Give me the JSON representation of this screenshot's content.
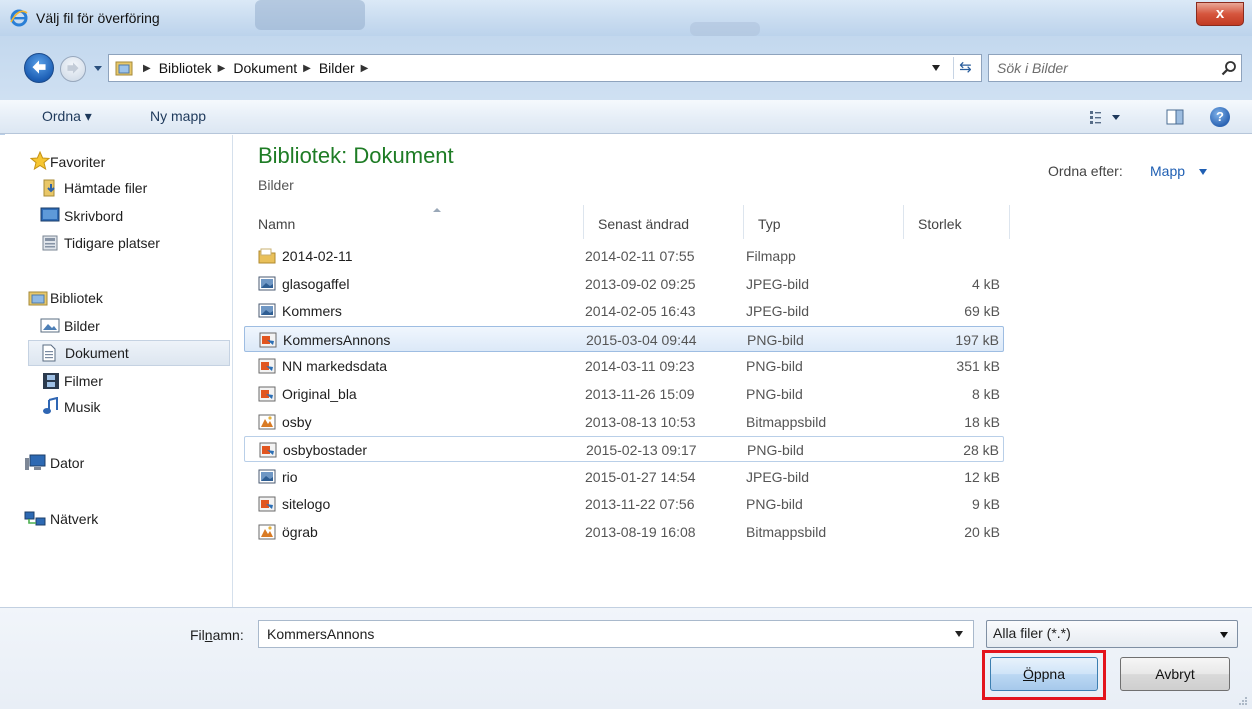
{
  "window": {
    "title": "Välj fil för överföring",
    "close_label": "x"
  },
  "breadcrumb": [
    "Bibliotek",
    "Dokument",
    "Bilder"
  ],
  "search": {
    "placeholder": "Sök i Bilder"
  },
  "toolbar": {
    "organize_label": "Ordna ▾",
    "new_folder_label": "Ny mapp",
    "help_label": "?"
  },
  "sidebar": {
    "items": [
      {
        "label": "Favoriter",
        "icon": "star-icon"
      },
      {
        "label": "Hämtade filer",
        "icon": "downloads-folder-icon"
      },
      {
        "label": "Skrivbord",
        "icon": "desktop-icon"
      },
      {
        "label": "Tidigare platser",
        "icon": "recent-places-icon"
      },
      {
        "label": "Bibliotek",
        "icon": "library-icon"
      },
      {
        "label": "Bilder",
        "icon": "pictures-icon"
      },
      {
        "label": "Dokument",
        "icon": "document-icon",
        "selected": true
      },
      {
        "label": "Filmer",
        "icon": "film-icon"
      },
      {
        "label": "Musik",
        "icon": "music-icon"
      },
      {
        "label": "Dator",
        "icon": "computer-icon"
      },
      {
        "label": "Nätverk",
        "icon": "network-icon"
      }
    ]
  },
  "library": {
    "title": "Bibliotek: Dokument",
    "subtitle": "Bilder",
    "arrange_label": "Ordna efter:",
    "arrange_value": "Mapp"
  },
  "columns": {
    "name": "Namn",
    "date": "Senast ändrad",
    "type": "Typ",
    "size": "Storlek"
  },
  "files": [
    {
      "name": "2014-02-11",
      "date": "2014-02-11 07:55",
      "type": "Filmapp",
      "size": "",
      "icon": "folder-icon"
    },
    {
      "name": "glasogaffel",
      "date": "2013-09-02 09:25",
      "type": "JPEG-bild",
      "size": "4 kB",
      "icon": "jpeg-icon"
    },
    {
      "name": "Kommers",
      "date": "2014-02-05 16:43",
      "type": "JPEG-bild",
      "size": "69 kB",
      "icon": "jpeg-icon"
    },
    {
      "name": "KommersAnnons",
      "date": "2015-03-04 09:44",
      "type": "PNG-bild",
      "size": "197 kB",
      "icon": "png-icon",
      "state": "selected"
    },
    {
      "name": "NN markedsdata",
      "date": "2014-03-11 09:23",
      "type": "PNG-bild",
      "size": "351 kB",
      "icon": "png-icon"
    },
    {
      "name": "Original_bla",
      "date": "2013-11-26 15:09",
      "type": "PNG-bild",
      "size": "8 kB",
      "icon": "png-icon"
    },
    {
      "name": "osby",
      "date": "2013-08-13 10:53",
      "type": "Bitmappsbild",
      "size": "18 kB",
      "icon": "bitmap-icon"
    },
    {
      "name": "osbybostader",
      "date": "2015-02-13 09:17",
      "type": "PNG-bild",
      "size": "28 kB",
      "icon": "png-icon",
      "state": "hovered"
    },
    {
      "name": "rio",
      "date": "2015-01-27 14:54",
      "type": "JPEG-bild",
      "size": "12 kB",
      "icon": "jpeg-icon"
    },
    {
      "name": "sitelogo",
      "date": "2013-11-22 07:56",
      "type": "PNG-bild",
      "size": "9 kB",
      "icon": "png-icon"
    },
    {
      "name": "ögrab",
      "date": "2013-08-19 16:08",
      "type": "Bitmappsbild",
      "size": "20 kB",
      "icon": "bitmap-icon"
    }
  ],
  "footer": {
    "filename_label_pre": "Fil",
    "filename_label_key": "n",
    "filename_label_post": "amn:",
    "filename_value": "KommersAnnons",
    "filetype_value": "Alla filer (*.*)",
    "open_key": "Ö",
    "open_rest": "ppna",
    "cancel_label": "Avbryt"
  },
  "colors": {
    "accent": "#1e7c25",
    "link": "#1f5fb3",
    "highlight": "#e3141d"
  }
}
